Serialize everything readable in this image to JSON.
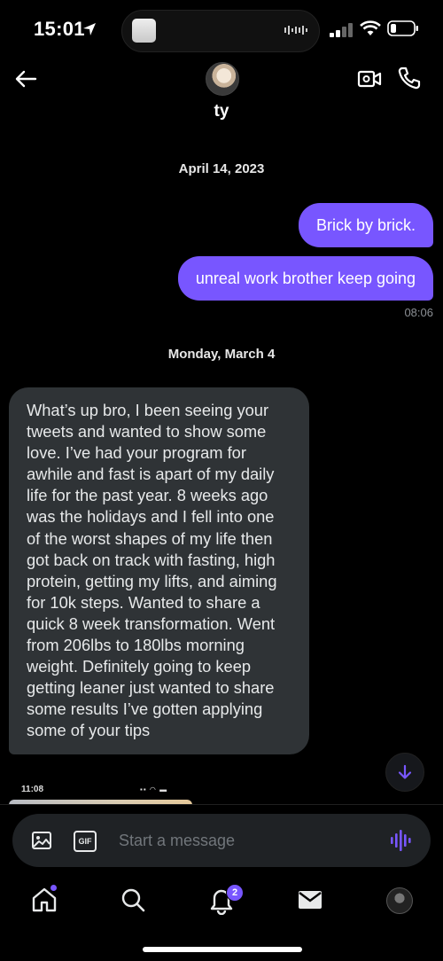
{
  "status_bar": {
    "time": "15:01",
    "icons": [
      "location-arrow-icon",
      "signal-icon",
      "wifi-icon",
      "battery-icon"
    ]
  },
  "header": {
    "contact_name": "ty",
    "icons": [
      "back-arrow-icon",
      "video-call-icon",
      "phone-icon"
    ]
  },
  "conversation": {
    "sections": [
      {
        "date": "April 14, 2023",
        "messages": [
          {
            "direction": "outgoing",
            "text": "Brick by brick."
          },
          {
            "direction": "outgoing",
            "text": "unreal work brother keep going"
          }
        ],
        "timestamp": "08:06"
      },
      {
        "date": "Monday, March 4",
        "messages": [
          {
            "direction": "incoming",
            "text": "What’s up bro, I been seeing your tweets and wanted to show some love. I’ve had your program for awhile and fast is apart of my daily life for the past year. 8 weeks ago was the holidays and I fell into one of the worst shapes of my life then got back on track with fasting, high protein, getting my lifts, and aiming for 10k steps. Wanted to share a quick 8 week transformation. Went from 206lbs to 180lbs morning weight. Definitely going to keep getting leaner just wanted to share some results I’ve gotten applying some of your tips"
          }
        ],
        "attachment_preview": {
          "time": "11:08"
        }
      }
    ]
  },
  "composer": {
    "placeholder": "Start a message",
    "gif_label": "GIF"
  },
  "bottom_nav": {
    "items": [
      "home-icon",
      "search-icon",
      "notifications-icon",
      "messages-icon",
      "profile-avatar"
    ],
    "notifications_badge": "2"
  },
  "colors": {
    "accent": "#7856ff",
    "incoming_bubble": "#2f3336",
    "background": "#000000"
  }
}
